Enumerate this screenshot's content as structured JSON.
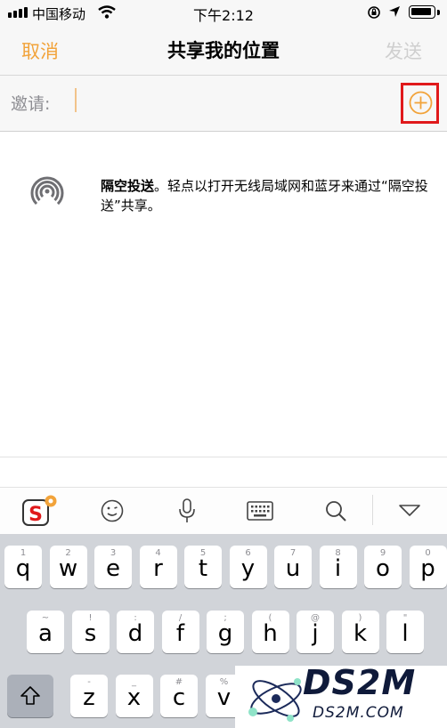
{
  "status_bar": {
    "carrier": "中国移动",
    "time": "下午2:12"
  },
  "nav": {
    "cancel": "取消",
    "title": "共享我的位置",
    "send": "发送"
  },
  "invite": {
    "label": "邀请:"
  },
  "airdrop": {
    "title": "隔空投送",
    "desc": "。轻点以打开无线局域网和蓝牙来通过“隔空投送”共享。"
  },
  "keyboard": {
    "row1": [
      [
        "q",
        "1"
      ],
      [
        "w",
        "2"
      ],
      [
        "e",
        "3"
      ],
      [
        "r",
        "4"
      ],
      [
        "t",
        "5"
      ],
      [
        "y",
        "6"
      ],
      [
        "u",
        "7"
      ],
      [
        "i",
        "8"
      ],
      [
        "o",
        "9"
      ],
      [
        "p",
        "0"
      ]
    ],
    "row2": [
      [
        "a",
        "~"
      ],
      [
        "s",
        "!"
      ],
      [
        "d",
        ":"
      ],
      [
        "f",
        "/"
      ],
      [
        "g",
        ";"
      ],
      [
        "h",
        "("
      ],
      [
        "j",
        "@"
      ],
      [
        "k",
        ")"
      ],
      [
        "l",
        "\""
      ]
    ],
    "row3": [
      [
        "z",
        "-"
      ],
      [
        "x",
        "_"
      ],
      [
        "c",
        "#"
      ],
      [
        "v",
        "%"
      ]
    ]
  },
  "watermark": {
    "brand": "DS2M",
    "site": "DS2M.COM"
  },
  "colors": {
    "accent": "#f2a33a",
    "highlight": "#e0191b"
  }
}
